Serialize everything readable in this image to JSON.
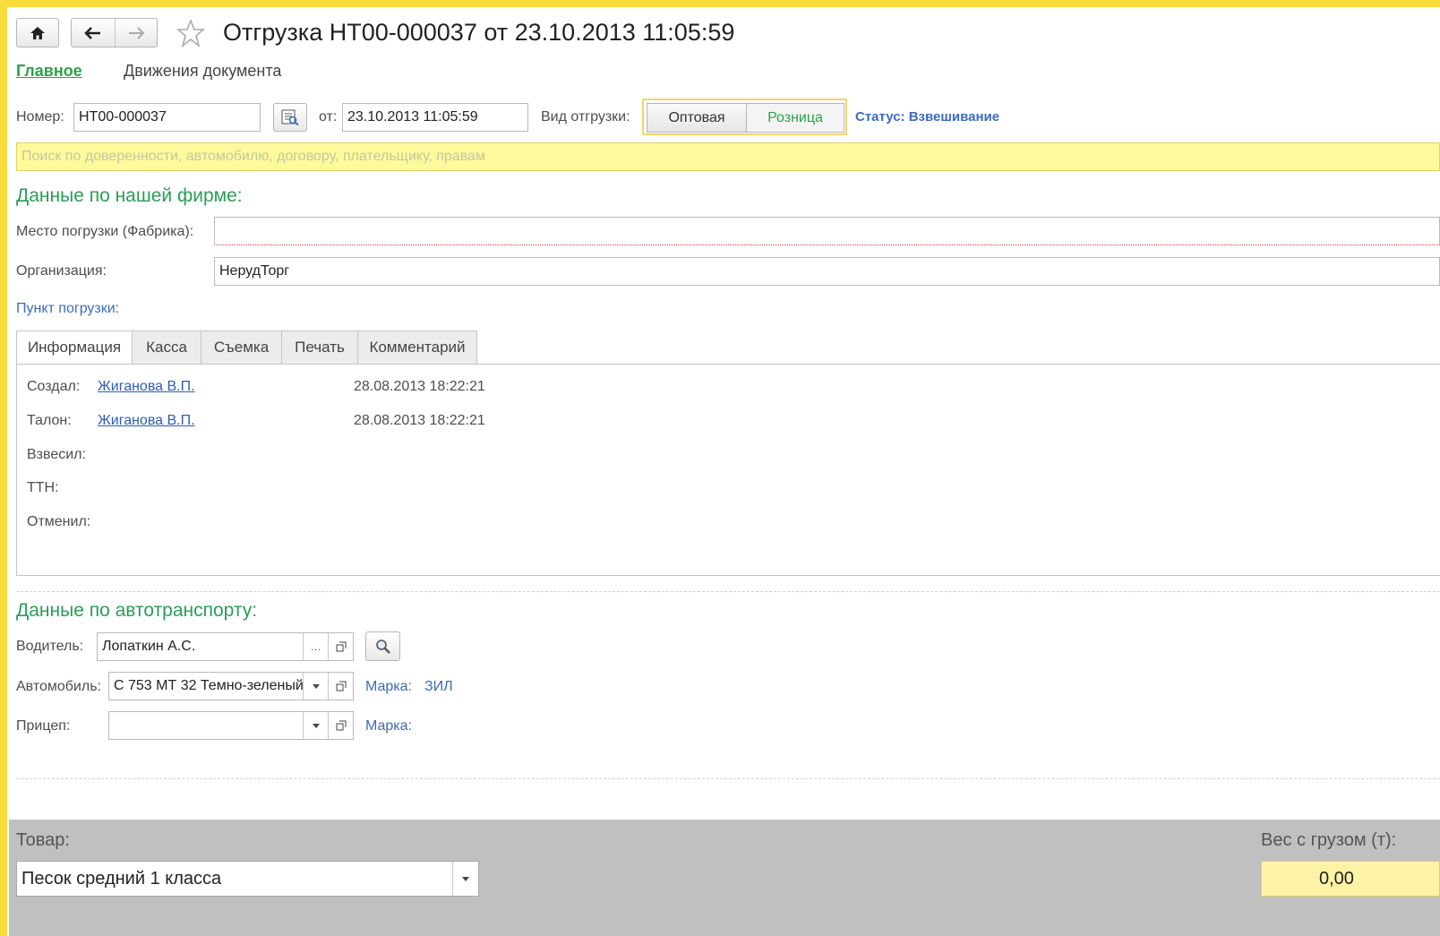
{
  "header": {
    "title": "Отгрузка НТ00-000037 от 23.10.2013 11:05:59",
    "nav_tabs": [
      "Главное",
      "Движения документа"
    ]
  },
  "doc": {
    "number_label": "Номер:",
    "number_value": "НТ00-000037",
    "date_label": "от:",
    "date_value": "23.10.2013 11:05:59",
    "shipment_type_label": "Вид отгрузки:",
    "shipment_options": [
      "Оптовая",
      "Розница"
    ],
    "status_label": "Статус:",
    "status_value": "Взвешивание",
    "search_placeholder": "Поиск по доверенности, автомобилю, договору, плательщику, правам"
  },
  "firm": {
    "section_title": "Данные по нашей фирме:",
    "load_place_label": "Место погрузки (Фабрика):",
    "load_place_value": "",
    "org_label": "Организация:",
    "org_value": "НерудТорг",
    "load_point_label": "Пункт погрузки:"
  },
  "tabs": [
    "Информация",
    "Касса",
    "Съемка",
    "Печать",
    "Комментарий"
  ],
  "info": {
    "created_label": "Создал:",
    "created_user": "Жиганова В.П.",
    "created_date": "28.08.2013 18:22:21",
    "ticket_label": "Талон:",
    "ticket_user": "Жиганова В.П.",
    "ticket_date": "28.08.2013 18:22:21",
    "weighed_label": "Взвесил:",
    "ttn_label": "ТТН:",
    "cancelled_label": "Отменил:"
  },
  "transport": {
    "section_title": "Данные по автотранспорту:",
    "driver_label": "Водитель:",
    "driver_value": "Лопаткин А.С.",
    "car_label": "Автомобиль:",
    "car_value": "С 753 МТ 32  Темно-зеленый",
    "car_brand_label": "Марка:",
    "car_brand_value": "ЗИЛ",
    "trailer_label": "Прицеп:",
    "trailer_value": "",
    "trailer_brand_label": "Марка:"
  },
  "goods": {
    "product_label": "Товар:",
    "product_value": "Песок средний 1 класса",
    "weight_label": "Вес с грузом (т):",
    "weight_value": "0,00"
  },
  "colors": {
    "frame": "#f8dc3c",
    "accent_green": "#2aa34a",
    "link_blue": "#2e5cb8",
    "search_bg": "#fdfa9c",
    "bottom_panel": "#c0c0c0",
    "weight_bg": "#fdf3a6"
  },
  "icons": [
    "home-icon",
    "back-arrow-icon",
    "forward-arrow-icon",
    "star-icon",
    "select-from-list-icon",
    "magnifier-icon",
    "open-icon",
    "dropdown-arrow-icon"
  ]
}
